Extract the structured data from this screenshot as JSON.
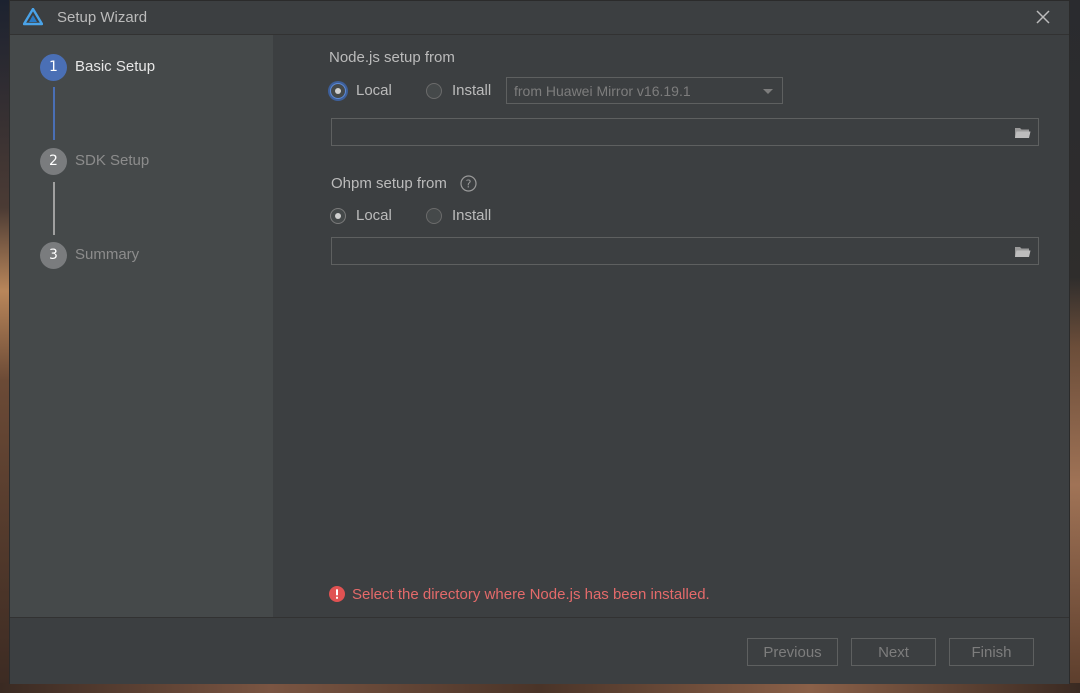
{
  "window": {
    "title": "Setup Wizard"
  },
  "colors": {
    "accent": "#4a6fb5",
    "error": "#e46a6a",
    "sidebar_bg": "#45494a"
  },
  "steps": [
    {
      "number": "1",
      "label": "Basic Setup",
      "active": true
    },
    {
      "number": "2",
      "label": "SDK Setup",
      "active": false
    },
    {
      "number": "3",
      "label": "Summary",
      "active": false
    }
  ],
  "nodejs": {
    "label": "Node.js setup from",
    "local_label": "Local",
    "install_label": "Install",
    "selected": "Local",
    "mirror_select": "from Huawei Mirror v16.19.1",
    "path_value": ""
  },
  "ohpm": {
    "label": "Ohpm setup from",
    "local_label": "Local",
    "install_label": "Install",
    "selected": "Local",
    "path_value": ""
  },
  "error_message": "Select the directory where Node.js has been installed.",
  "buttons": {
    "previous": "Previous",
    "next": "Next",
    "finish": "Finish"
  },
  "icons": {
    "logo": "deveco-logo-icon",
    "close": "close-icon",
    "folder": "folder-icon",
    "help": "help-icon",
    "error": "error-icon"
  }
}
